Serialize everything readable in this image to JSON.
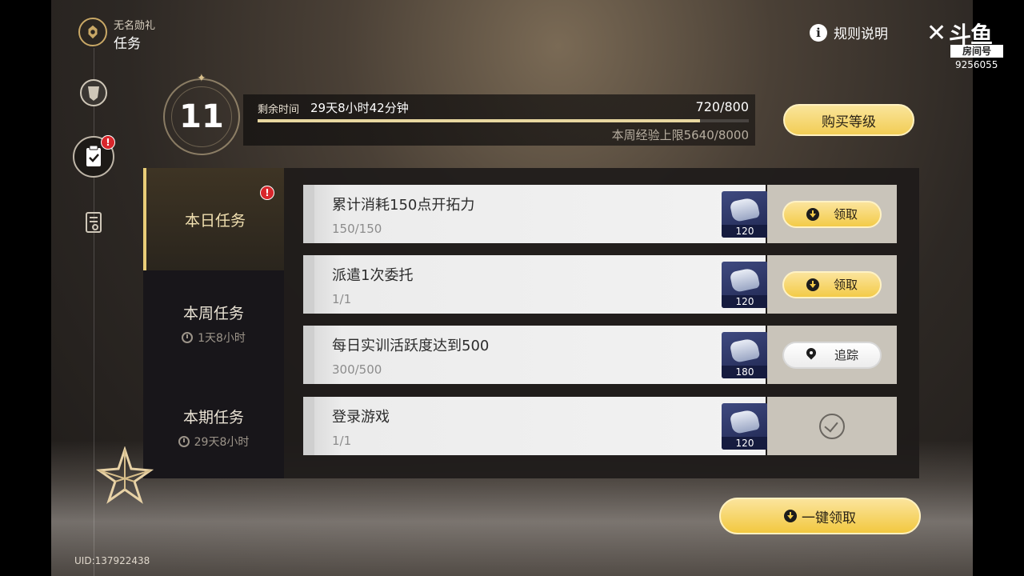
{
  "header": {
    "subtitle": "无名勋礼",
    "title": "任务"
  },
  "rules_label": "规则说明",
  "level": {
    "value": "11"
  },
  "xp": {
    "remaining_label": "剩余时间",
    "remaining_time": "29天8小时42分钟",
    "value": "720/800",
    "progress_fraction": 0.9,
    "weekly_cap": "本周经验上限5640/8000"
  },
  "buy_level_label": "购买等级",
  "nav": {
    "badge": "!"
  },
  "tabs": [
    {
      "label": "本日任务",
      "time": "",
      "badge": "!"
    },
    {
      "label": "本周任务",
      "time": "1天8小时"
    },
    {
      "label": "本期任务",
      "time": "29天8小时"
    }
  ],
  "tasks": [
    {
      "name": "累计消耗150点开拓力",
      "progress": "150/150",
      "reward": "120",
      "action": "领取",
      "state": "claim"
    },
    {
      "name": "派遣1次委托",
      "progress": "1/1",
      "reward": "120",
      "action": "领取",
      "state": "claim"
    },
    {
      "name": "每日实训活跃度达到500",
      "progress": "300/500",
      "reward": "180",
      "action": "追踪",
      "state": "track"
    },
    {
      "name": "登录游戏",
      "progress": "1/1",
      "reward": "120",
      "action": "",
      "state": "done"
    }
  ],
  "claim_all_label": "一键领取",
  "uid": "UID:137922438",
  "watermark": {
    "brand": "斗鱼",
    "room_label": "房间号",
    "room_id": "9256055"
  },
  "colors": {
    "accent_gold": "#f3cb48",
    "badge_red": "#d8262b"
  }
}
